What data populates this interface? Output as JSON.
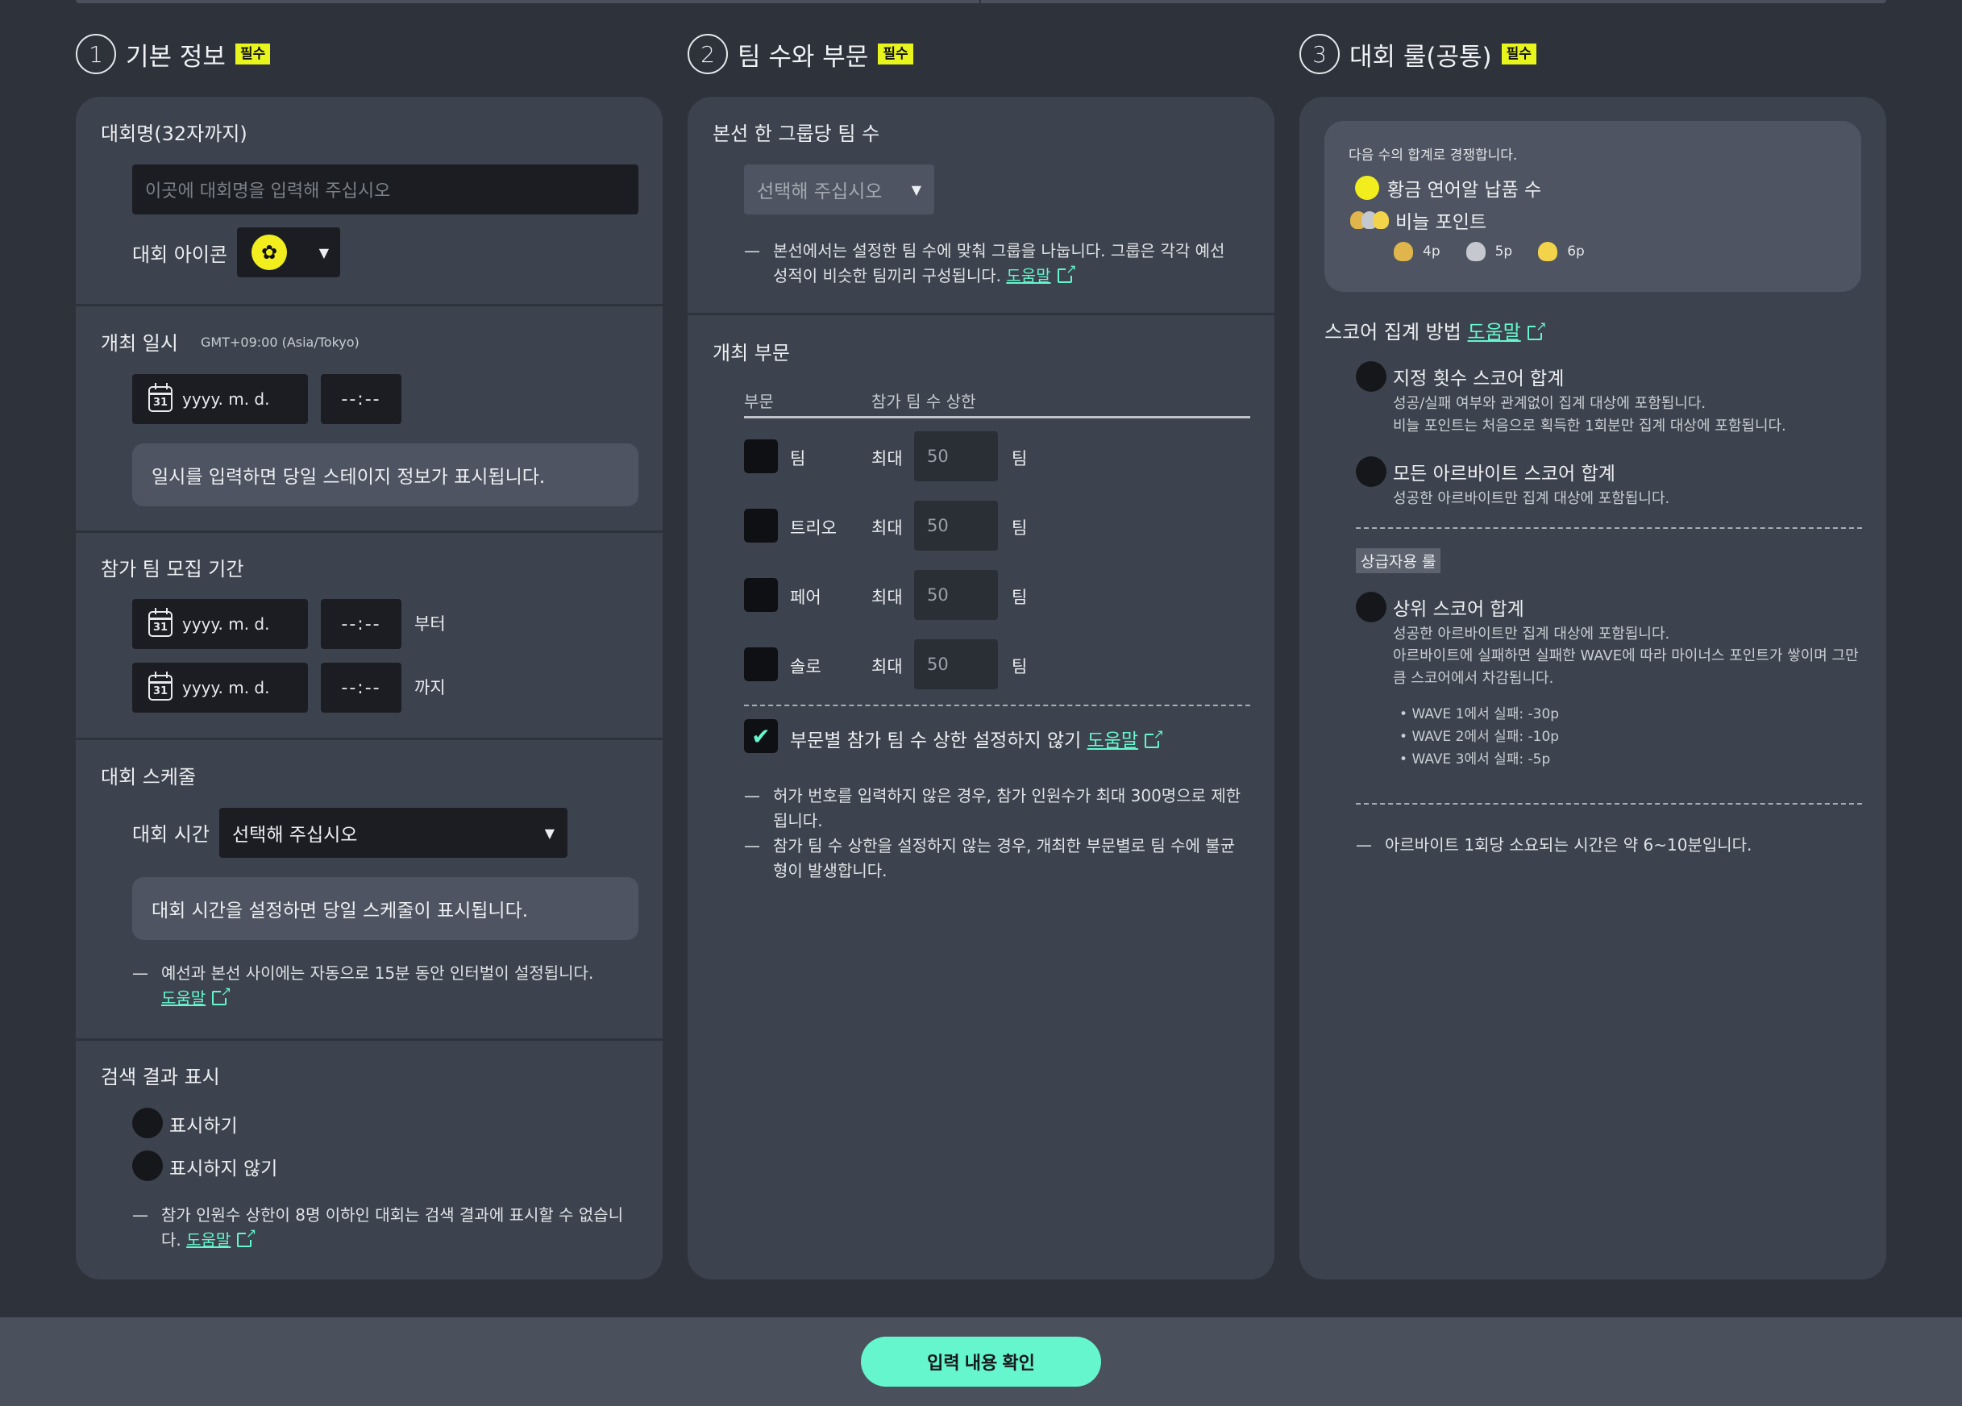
{
  "sections": [
    {
      "num": "1",
      "title": "기본 정보",
      "badge": "필수"
    },
    {
      "num": "2",
      "title": "팀 수와 부문",
      "badge": "필수"
    },
    {
      "num": "3",
      "title": "대회 룰(공통)",
      "badge": "필수"
    }
  ],
  "basic": {
    "name_label": "대회명(32자까지)",
    "name_placeholder": "이곳에 대회명을 입력해 주십시오",
    "icon_label": "대회 아이콘",
    "datetime_label": "개최 일시",
    "timezone": "GMT+09:00 (Asia/Tokyo)",
    "date_placeholder": "yyyy. m. d.",
    "time_placeholder": "--:--",
    "cal_num": "31",
    "datetime_info": "일시를 입력하면 당일 스테이지 정보가 표시됩니다.",
    "recruit_label": "참가 팀 모집 기간",
    "from": "부터",
    "to": "까지",
    "schedule_label": "대회 스케줄",
    "duration_label": "대회 시간",
    "duration_select": "선택해 주십시오",
    "schedule_info": "대회 시간을 설정하면 당일 스케줄이 표시됩니다.",
    "schedule_note": "예선과 본선 사이에는 자동으로 15분 동안 인터벌이 설정됩니다.",
    "help": "도움말",
    "search_label": "검색 결과 표시",
    "show": "표시하기",
    "hide": "표시하지 않기",
    "search_note": "참가 인원수 상한이 8명 이하인 대회는 검색 결과에 표시할 수 없습니다."
  },
  "teams": {
    "group_label": "본선 한 그룹당 팀 수",
    "group_select": "선택해 주십시오",
    "group_note": "본선에서는 설정한 팀 수에 맞춰 그룹을 나눕니다. 그룹은 각각 예선 성적이 비슷한 팀끼리 구성됩니다.",
    "help": "도움말",
    "division_label": "개최 부문",
    "th_division": "부문",
    "th_limit": "참가 팀 수 상한",
    "max": "최대",
    "unit": "팀",
    "rows": [
      {
        "name": "팀",
        "value": "50"
      },
      {
        "name": "트리오",
        "value": "50"
      },
      {
        "name": "페어",
        "value": "50"
      },
      {
        "name": "솔로",
        "value": "50"
      }
    ],
    "no_limit_label": "부문별 참가 팀 수 상한 설정하지 않기",
    "notes": [
      "허가 번호를 입력하지 않은 경우, 참가 인원수가 최대 300명으로 제한됩니다.",
      "참가 팀 수 상한을 설정하지 않는 경우, 개최한 부문별로 팀 수에 불균형이 발생합니다."
    ]
  },
  "rules": {
    "compete_intro": "다음 수의 합계로 경쟁합니다.",
    "golden_eggs": "황금 연어알 납품 수",
    "scales": "비늘 포인트",
    "scale_points": [
      "4p",
      "5p",
      "6p"
    ],
    "score_method_label": "스코어 집계 방법",
    "help": "도움말",
    "opt1_title": "지정 횟수 스코어 합계",
    "opt1_desc1": "성공/실패 여부와 관계없이 집계 대상에 포함됩니다.",
    "opt1_desc2": "비늘 포인트는 처음으로 획득한 1회분만 집계 대상에 포함됩니다.",
    "opt2_title": "모든 아르바이트 스코어 합계",
    "opt2_desc": "성공한 아르바이트만 집계 대상에 포함됩니다.",
    "advanced_tag": "상급자용 룰",
    "opt3_title": "상위 스코어 합계",
    "opt3_desc1": "성공한 아르바이트만 집계 대상에 포함됩니다.",
    "opt3_desc2": "아르바이트에 실패하면 실패한 WAVE에 따라 마이너스 포인트가 쌓이며 그만큼 스코어에서 차감됩니다.",
    "penalties": [
      "WAVE 1에서 실패:  -30p",
      "WAVE 2에서 실패:  -10p",
      "WAVE 3에서 실패:    -5p"
    ],
    "time_note": "아르바이트 1회당 소요되는 시간은 약 6~10분입니다."
  },
  "footer": {
    "confirm": "입력 내용 확인"
  },
  "colors": {
    "accent": "#66f6cd",
    "badge": "#e8f51d",
    "panel": "#3d434e",
    "bg": "#2d323b"
  }
}
